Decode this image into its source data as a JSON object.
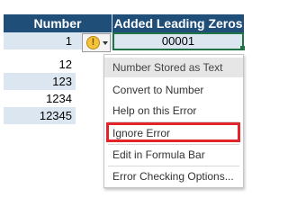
{
  "sheet": {
    "header_number": "Number",
    "header_zeros": "Added Leading Zeros",
    "numbers": [
      "1",
      "12",
      "123",
      "1234",
      "12345"
    ],
    "active_value": "00001"
  },
  "error_indicator": {
    "glyph": "!"
  },
  "menu": {
    "title": "Number Stored as Text",
    "items": [
      "Convert to Number",
      "Help on this Error",
      "Ignore Error",
      "Edit in Formula Bar",
      "Error Checking Options..."
    ]
  },
  "colors": {
    "header_bg": "#1f4e79",
    "band_bg": "#dce6f1",
    "selection": "#217346",
    "highlight": "#e2242b"
  }
}
